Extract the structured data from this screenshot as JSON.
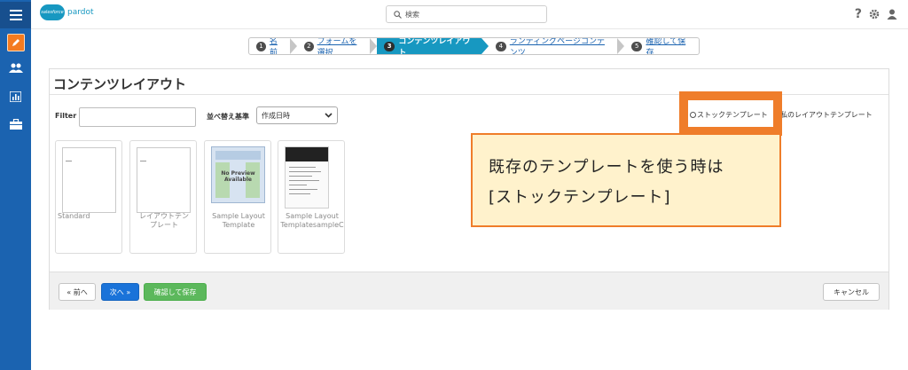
{
  "app": {
    "brand_cloud": "salesforce",
    "brand_name": "pardot"
  },
  "search": {
    "placeholder": "検索"
  },
  "wizard": {
    "steps": [
      {
        "num": "1",
        "label": "名前"
      },
      {
        "num": "2",
        "label": "フォームを選択"
      },
      {
        "num": "3",
        "label": "コンテンツレイアウト"
      },
      {
        "num": "4",
        "label": "ランディングページコンテンツ"
      },
      {
        "num": "5",
        "label": "確認して保存"
      }
    ],
    "active_step": 3
  },
  "panel": {
    "title": "コンテンツレイアウト",
    "filter_label": "Filter",
    "filter_value": "",
    "sort_label": "並べ替え基準",
    "sort_selected": "作成日時"
  },
  "template_source": {
    "stock_label": "ストックテンプレート",
    "mine_label": "私のレイアウトテンプレート"
  },
  "templates": [
    {
      "name": "Standard"
    },
    {
      "name": "レイアウトテン\nプレート"
    },
    {
      "name": "Sample Layout\nTemplate",
      "preview_text": "No Preview\nAvailable"
    },
    {
      "name": "Sample Layout\nTemplatesampleC"
    }
  ],
  "footer": {
    "prev_label": "« 前へ",
    "next_label": "次へ »",
    "save_label": "確認して保存",
    "cancel_label": "キャンセル"
  },
  "annotation": {
    "line1": "既存のテンプレートを使う時は",
    "line2": "[ストックテンプレート]"
  },
  "colors": {
    "sidebar": "#1b63b0",
    "accent": "#1798c1",
    "highlight": "#ef7d2a",
    "callout_bg": "#fff2cc",
    "save_green": "#5cb85c",
    "next_blue": "#1a73d9"
  }
}
